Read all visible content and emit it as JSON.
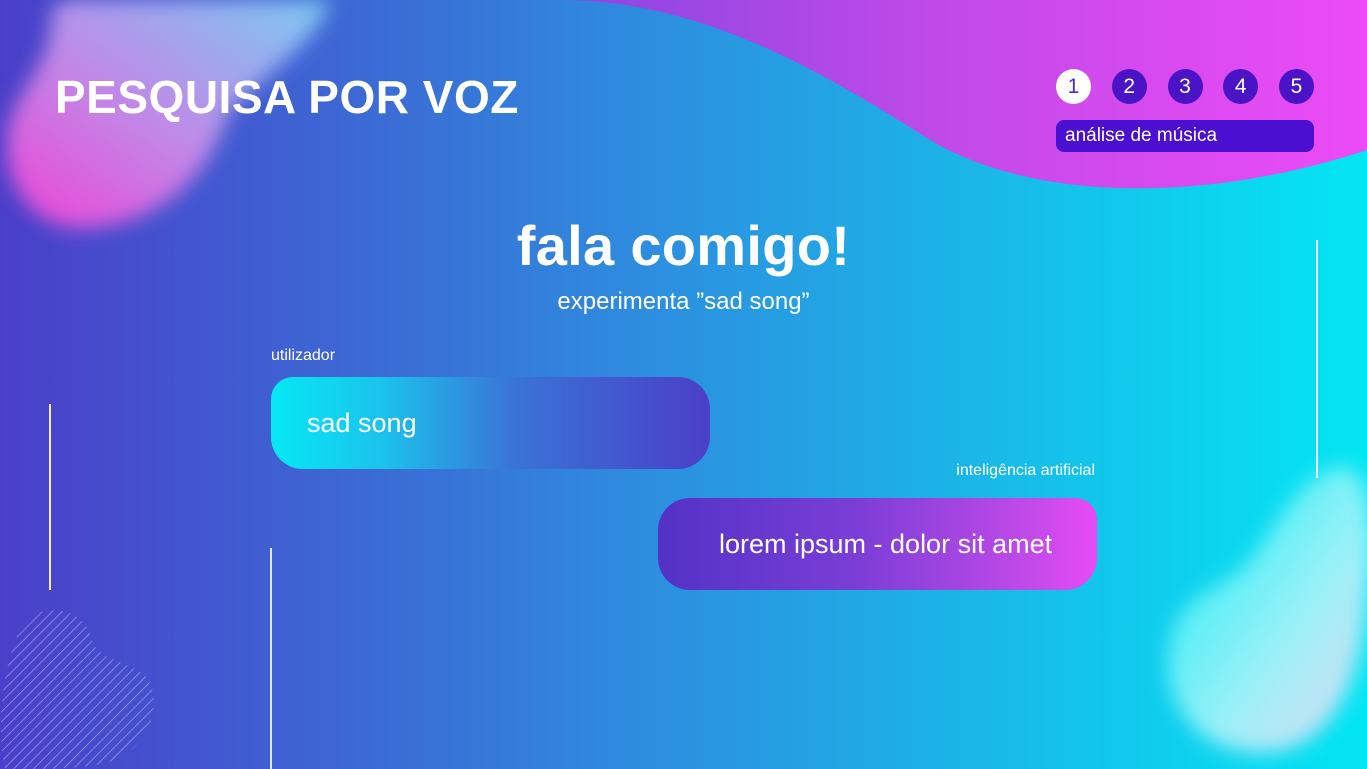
{
  "header": {
    "title": "PESQUISA POR VOZ"
  },
  "progress": {
    "steps": [
      "1",
      "2",
      "3",
      "4",
      "5"
    ],
    "current_step": 1,
    "current_label": "análise de música"
  },
  "main": {
    "headline": "fala comigo!",
    "hint": "experimenta ”sad song”"
  },
  "conversation": [
    {
      "speaker": "utilizador",
      "text": "sad song"
    },
    {
      "speaker": "inteligência artificial",
      "text": "lorem ipsum - dolor sit amet"
    }
  ],
  "colors": {
    "bg_left": "#4a3fc9",
    "bg_right": "#03e6f3",
    "accent_magenta": "#e84bf5",
    "step_inactive": "#4a14c6",
    "step_label_bg": "#4a0fd0",
    "text": "#ffffff"
  }
}
